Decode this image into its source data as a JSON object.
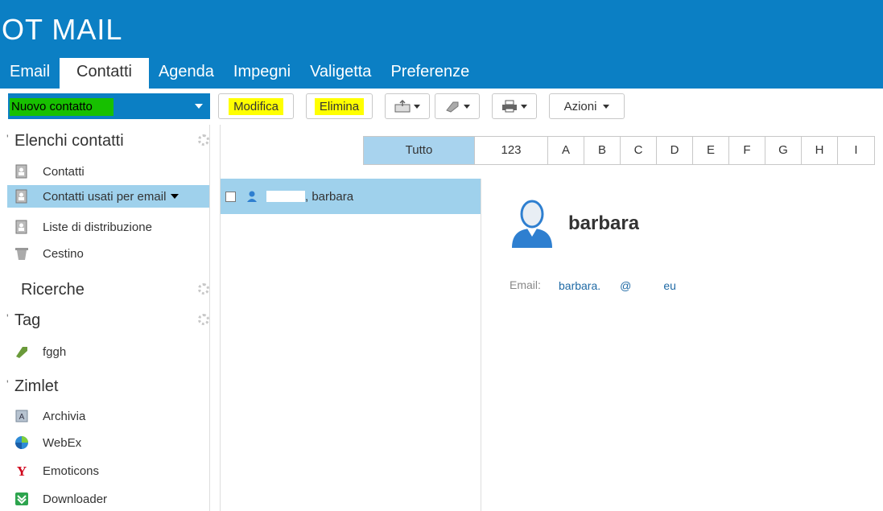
{
  "app": {
    "brand": "OT MAIL"
  },
  "tabs": [
    {
      "label": "Email"
    },
    {
      "label": "Contatti",
      "active": true
    },
    {
      "label": "Agenda"
    },
    {
      "label": "Impegni"
    },
    {
      "label": "Valigetta"
    },
    {
      "label": "Preferenze"
    }
  ],
  "toolbar": {
    "new_contact": "Nuovo contatto",
    "edit": "Modifica",
    "delete": "Elimina",
    "actions": "Azioni"
  },
  "sidebar": {
    "contact_lists_title": "Elenchi contatti",
    "contact_lists": [
      {
        "label": "Contatti"
      },
      {
        "label": "Contatti usati per email",
        "selected": true
      },
      {
        "label": "Liste di distribuzione"
      },
      {
        "label": "Cestino"
      }
    ],
    "searches_title": "Ricerche",
    "tags_title": "Tag",
    "tags": [
      {
        "label": "fggh"
      }
    ],
    "zimlet_title": "Zimlet",
    "zimlets": [
      {
        "label": "Archivia"
      },
      {
        "label": "WebEx"
      },
      {
        "label": "Emoticons"
      },
      {
        "label": "Downloader"
      }
    ]
  },
  "alphabet": [
    "Tutto",
    "123",
    "A",
    "B",
    "C",
    "D",
    "E",
    "F",
    "G",
    "H",
    "I"
  ],
  "contact_list": [
    {
      "name": "barbara"
    }
  ],
  "detail": {
    "name": "barbara",
    "email_label": "Email:",
    "email_prefix": "barbara.",
    "email_mid": "@",
    "email_suffix": "eu"
  },
  "colors": {
    "header": "#0b7fc4",
    "highlight": "#ffff00",
    "selection": "#9fd1ec"
  }
}
